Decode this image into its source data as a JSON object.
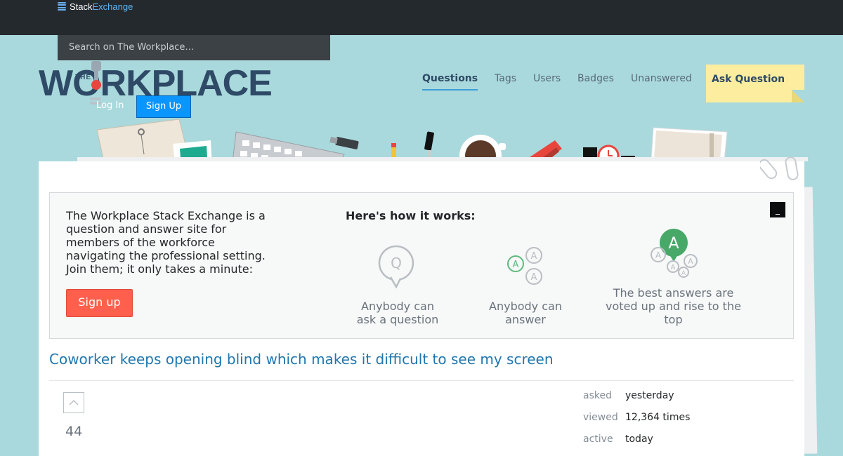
{
  "topbar": {
    "brand_part1": "Stack",
    "brand_part2": "Exchange"
  },
  "search": {
    "placeholder": "Search on The Workplace…"
  },
  "site": {
    "logo_small": "THE",
    "logo_main": "WORKPLACE"
  },
  "auth": {
    "login_label": "Log In",
    "signup_label": "Sign Up"
  },
  "nav": {
    "items": [
      "Questions",
      "Tags",
      "Users",
      "Badges",
      "Unanswered"
    ],
    "ask_label": "Ask Question"
  },
  "hero": {
    "description": "The Workplace Stack Exchange is a question and answer site for members of the workforce navigating the professional setting. Join them; it only takes a minute:",
    "signup_label": "Sign up",
    "how_title": "Here's how it works:",
    "steps": [
      "Anybody can ask a question",
      "Anybody can answer",
      "The best answers are voted up and rise to the top"
    ],
    "close_symbol": "_"
  },
  "question": {
    "title": "Coworker keeps opening blind which makes it difficult to see my screen",
    "votes": "44",
    "stats": [
      {
        "label": "asked",
        "value": "yesterday"
      },
      {
        "label": "viewed",
        "value": "12,364 times"
      },
      {
        "label": "active",
        "value": "today"
      }
    ]
  },
  "colors": {
    "accent": "#0a95ff",
    "signup_red": "#ff5f4d",
    "title_link": "#1f76ad",
    "background": "#a9d9dc"
  }
}
